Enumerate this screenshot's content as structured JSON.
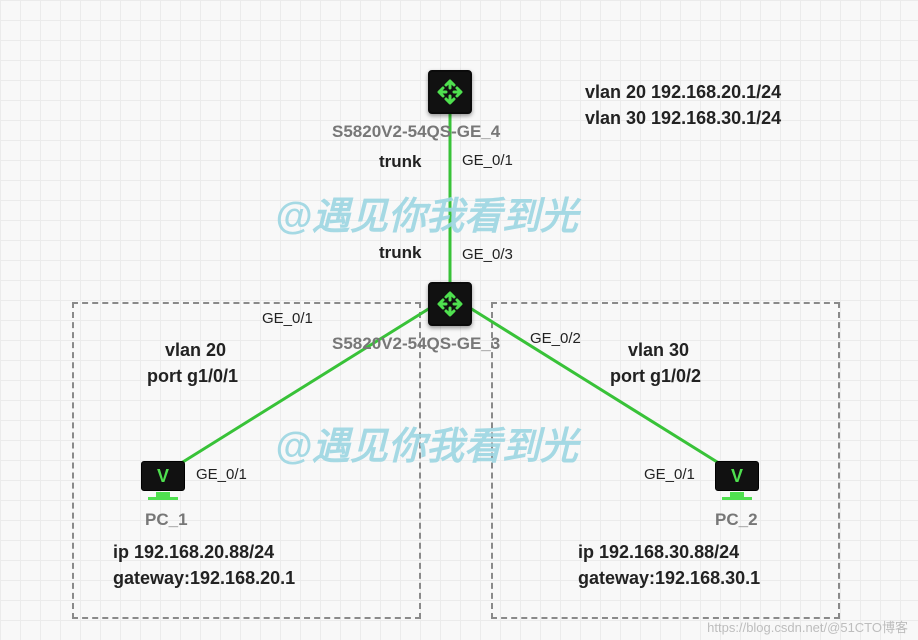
{
  "devices": {
    "switch_top": {
      "label": "S5820V2-54QS-GE_4"
    },
    "switch_bot": {
      "label": "S5820V2-54QS-GE_3"
    },
    "pc1": {
      "label": "PC_1"
    },
    "pc2": {
      "label": "PC_2"
    }
  },
  "ports": {
    "top_out": "GE_0/1",
    "bot_up": "GE_0/3",
    "bot_left": "GE_0/1",
    "bot_right": "GE_0/2",
    "pc1_port": "GE_0/1",
    "pc2_port": "GE_0/1"
  },
  "link_labels": {
    "trunk_top": "trunk",
    "trunk_bot": "trunk"
  },
  "annotations": {
    "vlan20_cfg": "vlan 20 192.168.20.1/24",
    "vlan30_cfg": "vlan 30 192.168.30.1/24",
    "left_grp_l1": "vlan 20",
    "left_grp_l2": "port g1/0/1",
    "right_grp_l1": "vlan 30",
    "right_grp_l2": "port g1/0/2",
    "pc1_ip": "ip 192.168.20.88/24",
    "pc1_gw": "gateway:192.168.20.1",
    "pc2_ip": "ip 192.168.30.88/24",
    "pc2_gw": "gateway:192.168.30.1"
  },
  "watermarks": {
    "wm1": "@遇见你我看到光",
    "wm2": "@遇见你我看到光",
    "footer": "https://blog.csdn.net/@51CTO博客"
  },
  "chart_data": {
    "type": "diagram",
    "title": "Network VLAN Trunk Topology",
    "nodes": [
      {
        "id": "SW4",
        "label": "S5820V2-54QS-GE_4",
        "type": "L3-switch",
        "interfaces": {
          "vlan20": "192.168.20.1/24",
          "vlan30": "192.168.30.1/24",
          "GE_0/1": "trunk"
        }
      },
      {
        "id": "SW3",
        "label": "S5820V2-54QS-GE_3",
        "type": "L2-switch",
        "interfaces": {
          "GE_0/3": "trunk",
          "GE_0/1": "access vlan 20",
          "GE_0/2": "access vlan 30"
        }
      },
      {
        "id": "PC_1",
        "type": "host",
        "ip": "192.168.20.88/24",
        "gateway": "192.168.20.1",
        "port": "GE_0/1"
      },
      {
        "id": "PC_2",
        "type": "host",
        "ip": "192.168.30.88/24",
        "gateway": "192.168.30.1",
        "port": "GE_0/1"
      }
    ],
    "edges": [
      {
        "from": "SW4:GE_0/1",
        "to": "SW3:GE_0/3",
        "mode": "trunk"
      },
      {
        "from": "SW3:GE_0/1",
        "to": "PC_1:GE_0/1",
        "vlan": 20
      },
      {
        "from": "SW3:GE_0/2",
        "to": "PC_2:GE_0/1",
        "vlan": 30
      }
    ],
    "groups": [
      {
        "name": "vlan 20",
        "members": [
          "PC_1"
        ],
        "access_port": "g1/0/1"
      },
      {
        "name": "vlan 30",
        "members": [
          "PC_2"
        ],
        "access_port": "g1/0/2"
      }
    ]
  }
}
